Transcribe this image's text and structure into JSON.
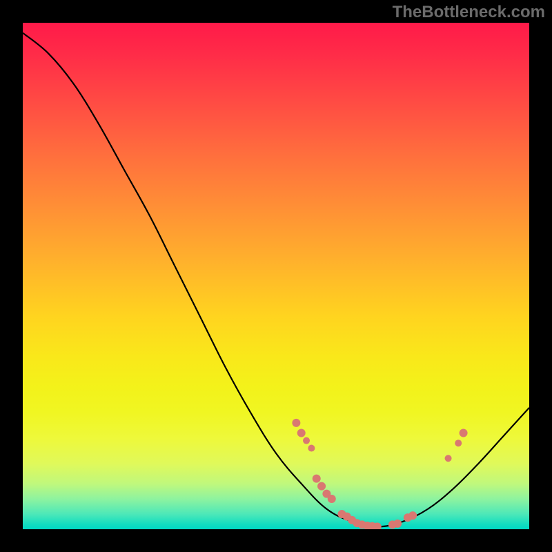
{
  "watermark": "TheBottleneck.com",
  "chart_data": {
    "type": "line",
    "title": "",
    "xlabel": "",
    "ylabel": "",
    "xlim": [
      0,
      100
    ],
    "ylim": [
      0,
      100
    ],
    "curve": [
      {
        "x": 0,
        "y": 98
      },
      {
        "x": 5,
        "y": 94
      },
      {
        "x": 10,
        "y": 88
      },
      {
        "x": 15,
        "y": 80
      },
      {
        "x": 20,
        "y": 71
      },
      {
        "x": 25,
        "y": 62
      },
      {
        "x": 30,
        "y": 52
      },
      {
        "x": 35,
        "y": 42
      },
      {
        "x": 40,
        "y": 32
      },
      {
        "x": 45,
        "y": 23
      },
      {
        "x": 50,
        "y": 15
      },
      {
        "x": 55,
        "y": 9
      },
      {
        "x": 60,
        "y": 4
      },
      {
        "x": 65,
        "y": 1.5
      },
      {
        "x": 70,
        "y": 0.5
      },
      {
        "x": 75,
        "y": 1.5
      },
      {
        "x": 80,
        "y": 4
      },
      {
        "x": 85,
        "y": 8
      },
      {
        "x": 90,
        "y": 13
      },
      {
        "x": 95,
        "y": 18.5
      },
      {
        "x": 100,
        "y": 24
      }
    ],
    "datapoints": [
      {
        "x": 54,
        "y": 21,
        "r": 6
      },
      {
        "x": 55,
        "y": 19,
        "r": 6
      },
      {
        "x": 56,
        "y": 17.5,
        "r": 5
      },
      {
        "x": 57,
        "y": 16,
        "r": 5
      },
      {
        "x": 58,
        "y": 10,
        "r": 6
      },
      {
        "x": 59,
        "y": 8.5,
        "r": 6
      },
      {
        "x": 60,
        "y": 7,
        "r": 6
      },
      {
        "x": 61,
        "y": 6,
        "r": 6
      },
      {
        "x": 63,
        "y": 3,
        "r": 6
      },
      {
        "x": 64,
        "y": 2.5,
        "r": 6
      },
      {
        "x": 65,
        "y": 1.8,
        "r": 6
      },
      {
        "x": 66,
        "y": 1.2,
        "r": 6
      },
      {
        "x": 67,
        "y": 0.9,
        "r": 6
      },
      {
        "x": 68,
        "y": 0.7,
        "r": 6
      },
      {
        "x": 69,
        "y": 0.6,
        "r": 6
      },
      {
        "x": 70,
        "y": 0.5,
        "r": 6
      },
      {
        "x": 73,
        "y": 0.9,
        "r": 6
      },
      {
        "x": 74,
        "y": 1.1,
        "r": 6
      },
      {
        "x": 76,
        "y": 2.3,
        "r": 6
      },
      {
        "x": 77,
        "y": 2.7,
        "r": 6
      },
      {
        "x": 84,
        "y": 14,
        "r": 5
      },
      {
        "x": 86,
        "y": 17,
        "r": 5
      },
      {
        "x": 87,
        "y": 19,
        "r": 6
      }
    ],
    "gradient_stops": [
      {
        "pos": 0,
        "color": "#ff1a49"
      },
      {
        "pos": 50,
        "color": "#ffd41f"
      },
      {
        "pos": 100,
        "color": "#00d8c4"
      }
    ]
  }
}
